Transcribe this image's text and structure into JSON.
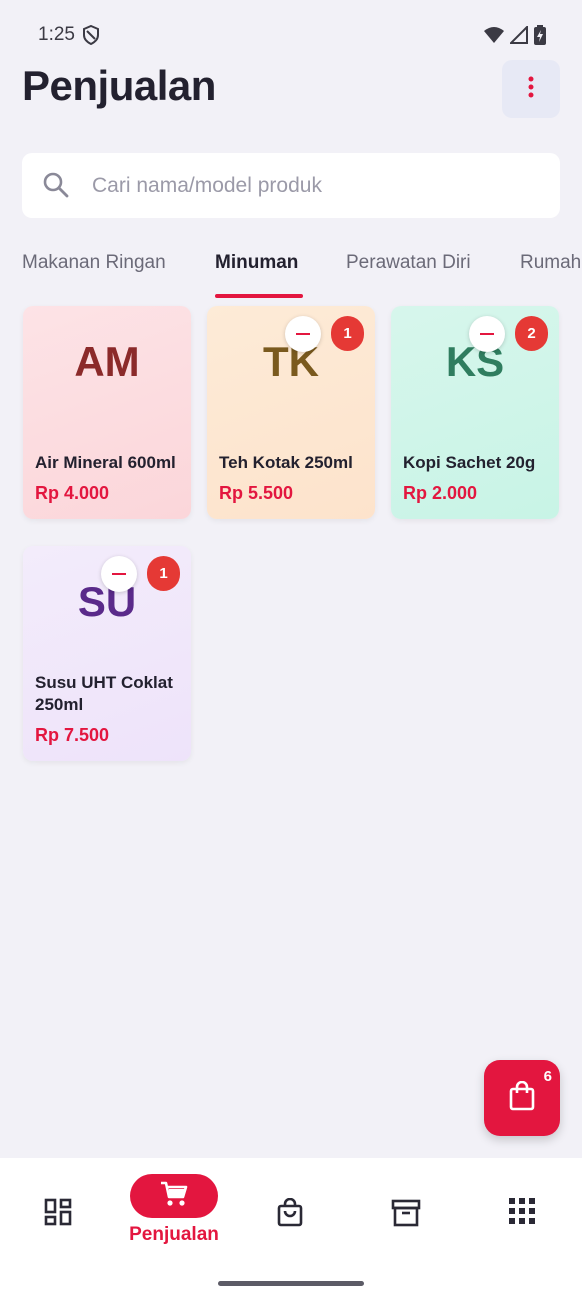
{
  "status_bar": {
    "time": "1:25"
  },
  "header": {
    "title": "Penjualan"
  },
  "search": {
    "placeholder": "Cari nama/model produk",
    "value": ""
  },
  "tabs": [
    {
      "label": "Makanan Ringan",
      "active": false
    },
    {
      "label": "Minuman",
      "active": true
    },
    {
      "label": "Perawatan Diri",
      "active": false
    },
    {
      "label": "Rumah",
      "active": false
    }
  ],
  "products": [
    {
      "initials": "AM",
      "name": "Air Mineral 600ml",
      "price": "Rp 4.000",
      "qty": null,
      "color": "#8b2a2a"
    },
    {
      "initials": "TK",
      "name": "Teh Kotak 250ml",
      "price": "Rp 5.500",
      "qty": "1",
      "color": "#7a5a1e"
    },
    {
      "initials": "KS",
      "name": "Kopi Sachet 20g",
      "price": "Rp 2.000",
      "qty": "2",
      "color": "#2f7d5f"
    },
    {
      "initials": "SU",
      "name": "Susu UHT Coklat 250ml",
      "price": "Rp 7.500",
      "qty": "1",
      "color": "#5a2a8a"
    }
  ],
  "cart": {
    "count": "6",
    "icon": "shopping-bag-icon"
  },
  "bottom_nav": [
    {
      "icon": "dashboard-icon",
      "label": ""
    },
    {
      "icon": "cart-icon",
      "label": "Penjualan",
      "active": true
    },
    {
      "icon": "bag-icon",
      "label": ""
    },
    {
      "icon": "archive-icon",
      "label": ""
    },
    {
      "icon": "apps-grid-icon",
      "label": ""
    }
  ],
  "colors": {
    "accent": "#e3163f",
    "background": "#f2f1f7"
  }
}
